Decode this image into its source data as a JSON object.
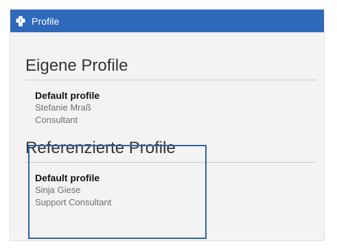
{
  "window": {
    "title": "Profile",
    "titlebar_color": "#2f69b9",
    "background_color": "#f3f3f3",
    "app_icon": "puzzle-icon"
  },
  "sections": {
    "own": {
      "title": "Eigene Profile",
      "profile": {
        "name": "Default profile",
        "person": "Stefanie Mraß",
        "role": "Consultant"
      }
    },
    "referenced": {
      "title": "Referenzierte Profile",
      "profile": {
        "name": "Default profile",
        "person": "Sinja Giese",
        "role": "Support Consultant"
      }
    }
  },
  "highlight_color": "#2f63aa"
}
